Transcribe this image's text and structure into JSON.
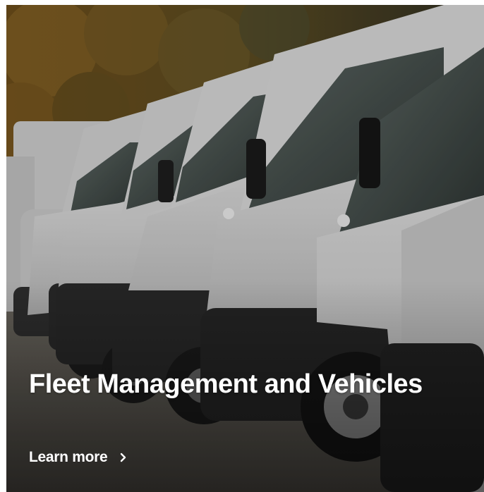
{
  "card": {
    "title": "Fleet Management and Vehicles",
    "link_label": "Learn more",
    "link_icon": "chevron-right-icon",
    "image_subject": "row-of-white-vans-photo"
  },
  "colors": {
    "text": "#ffffff",
    "foliage": "#7a5a22",
    "van_body": "#cfcfcf",
    "bumper": "#2d2d2d",
    "ground": "#6e6a62"
  }
}
